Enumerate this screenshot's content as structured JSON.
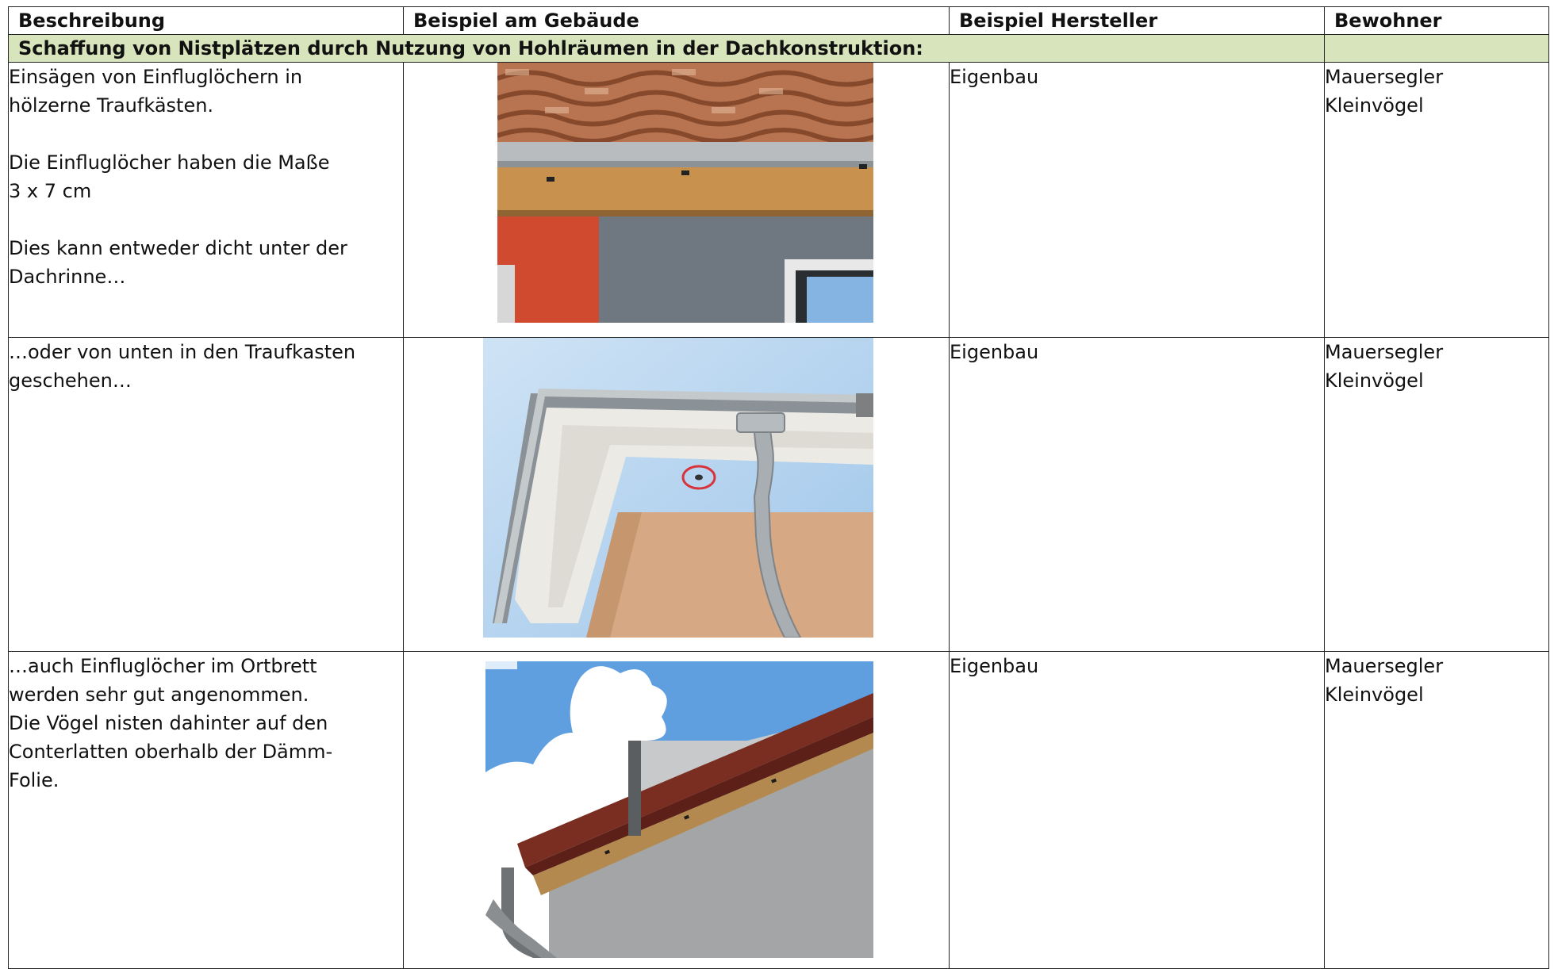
{
  "table": {
    "headers": {
      "description": "Beschreibung",
      "building_example": "Beispiel am Gebäude",
      "manufacturer_example": "Beispiel Hersteller",
      "residents": "Bewohner"
    },
    "section_title": "Schaffung von Nistplätzen durch Nutzung von Hohlräumen in der Dachkonstruktion:",
    "rows": [
      {
        "description": "Einsägen von Einfluglöchern in\nhölzerne Traufkästen.\n\nDie Einfluglöcher haben die Maße\n3 x 7 cm\n\nDies kann entweder dicht unter der\nDachrinne…",
        "manufacturer": "Eigenbau",
        "residents": "Mauersegler\nKleinvögel",
        "photo": "roof-eave-photo-tiles"
      },
      {
        "description": "…oder von unten in den Traufkasten\ngeschehen…",
        "manufacturer": "Eigenbau",
        "residents": "Mauersegler\nKleinvögel",
        "photo": "roof-eave-photo-from-below"
      },
      {
        "description": "…auch Einfluglöcher im Ortbrett\nwerden sehr gut angenommen.\nDie Vögel nisten dahinter auf den\nConterlatten oberhalb der Dämm-\nFolie.",
        "manufacturer": "Eigenbau",
        "residents": "Mauersegler\nKleinvögel",
        "photo": "gable-board-photo"
      }
    ]
  },
  "colors": {
    "section_band": "#d8e4bc",
    "border": "#222222"
  }
}
